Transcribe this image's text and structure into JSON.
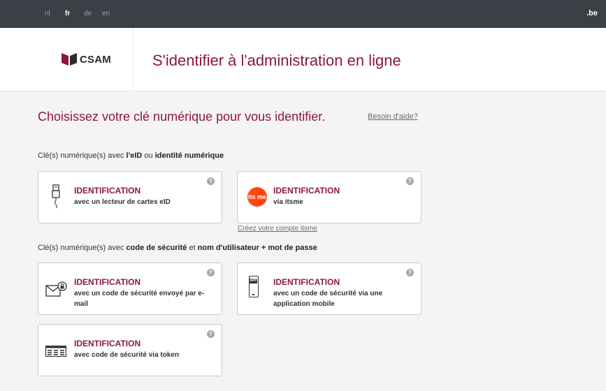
{
  "topbar": {
    "languages": [
      "nl",
      "fr",
      "de",
      "en"
    ],
    "active_language": "fr",
    "domain": ".be"
  },
  "header": {
    "logo_text": "CSAM",
    "title": "S'identifier à l'administration en ligne"
  },
  "main": {
    "heading": "Choisissez votre clé numérique pour vous identifier.",
    "help_link": "Besoin d'aide?",
    "section1": {
      "prefix": "Clé(s) numérique(s) avec ",
      "bold1": "l'eID",
      "middle": " ou ",
      "bold2": "identité numérique"
    },
    "section2": {
      "prefix": "Clé(s) numérique(s) avec ",
      "bold1": "code de sécurité",
      "middle": " et ",
      "bold2": "nom d'utilisateur + mot de passe"
    },
    "cards": [
      {
        "title": "IDENTIFICATION",
        "subtitle": "avec un lecteur de cartes eID",
        "icon": "card-reader-icon"
      },
      {
        "title": "IDENTIFICATION",
        "subtitle": "via itsme",
        "icon": "itsme-logo-icon",
        "icon_text": "its me"
      },
      {
        "title": "IDENTIFICATION",
        "subtitle": "avec un code de sécurité envoyé par e-mail",
        "icon": "envelope-lock-icon"
      },
      {
        "title": "IDENTIFICATION",
        "subtitle": "avec un code de sécurité via une application mobile",
        "icon": "mobile-app-icon",
        "icon_text": "APP"
      },
      {
        "title": "IDENTIFICATION",
        "subtitle": "avec code de sécurité via token",
        "icon": "token-icon"
      }
    ],
    "help_glyph": "?",
    "itsme_create_link": "Créez votre compte itsme"
  },
  "colors": {
    "topbar": "#3c3f45",
    "brand": "#8e1838",
    "content_bg": "#f4f4f4",
    "itsme": "#ff4612"
  }
}
